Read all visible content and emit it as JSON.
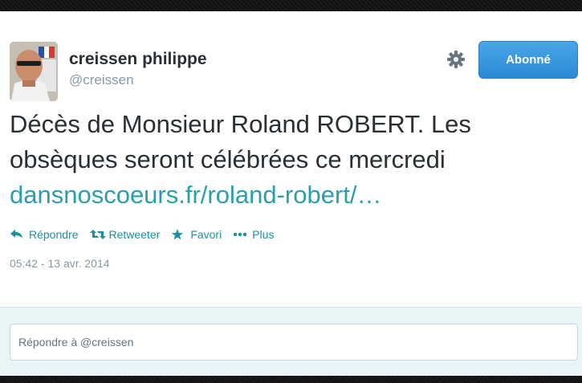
{
  "user": {
    "fullname": "creissen philippe",
    "screen_name": "@creissen",
    "avatar_icon": "profile-photo"
  },
  "header": {
    "settings_icon": "gear-icon",
    "follow_label": "Abonné"
  },
  "tweet": {
    "text_line1": "Décès de Monsieur Roland ROBERT. Les",
    "text_line2": "obsèques seront célébrées ce mercredi",
    "link": "dansnoscoeurs.fr/roland-robert/…"
  },
  "actions": {
    "reply": "Répondre",
    "retweet": "Retweeter",
    "favorite": "Favori",
    "more": "Plus"
  },
  "timestamp": "05:42 - 13 avr. 2014",
  "reply_box": {
    "placeholder": "Répondre à @creissen"
  },
  "colors": {
    "link": "#2a9fab",
    "action": "#1b8ea0",
    "follow_button": "#2b8ad6",
    "reply_background": "#e8f4f6"
  }
}
